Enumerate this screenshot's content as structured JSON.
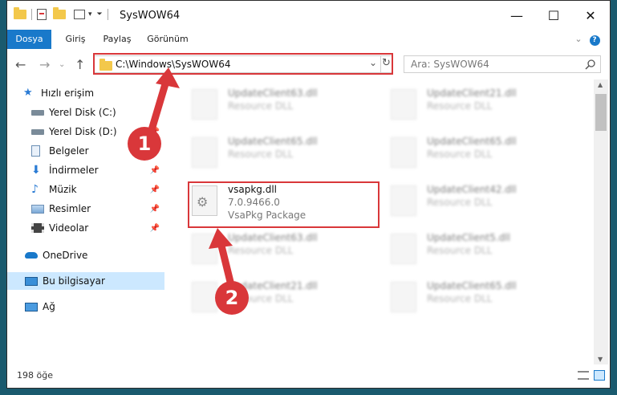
{
  "window": {
    "title": "SysWOW64",
    "minimize": "—",
    "maximize": "☐",
    "close": "✕"
  },
  "ribbon": {
    "tabs": [
      "Dosya",
      "Giriş",
      "Paylaş",
      "Görünüm"
    ],
    "expand": "⌄",
    "help": "?"
  },
  "address": {
    "path": "C:\\Windows\\SysWOW64",
    "back": "←",
    "forward": "→",
    "up": "↑",
    "refresh": "↻",
    "dropdown": "⌄"
  },
  "search": {
    "placeholder": "Ara: SysWOW64",
    "icon": "search-icon"
  },
  "sidebar": {
    "items": [
      {
        "label": "Hızlı erişim",
        "icon": "star-icon"
      },
      {
        "label": "Yerel Disk (C:)",
        "icon": "drive-icon"
      },
      {
        "label": "Yerel Disk (D:)",
        "icon": "drive-icon"
      },
      {
        "label": "Belgeler",
        "icon": "document-icon"
      },
      {
        "label": "İndirmeler",
        "icon": "download-icon"
      },
      {
        "label": "Müzik",
        "icon": "music-icon"
      },
      {
        "label": "Resimler",
        "icon": "picture-icon"
      },
      {
        "label": "Videolar",
        "icon": "video-icon"
      },
      {
        "label": "OneDrive",
        "icon": "cloud-icon"
      },
      {
        "label": "Bu bilgisayar",
        "icon": "computer-icon"
      },
      {
        "label": "Ağ",
        "icon": "network-icon"
      }
    ]
  },
  "files": [
    {
      "name": "UpdateClient63.dll",
      "sub": "Resource DLL"
    },
    {
      "name": "UpdateClient21.dll",
      "sub": "Resource DLL"
    },
    {
      "name": "UpdateClient65.dll",
      "sub": "Resource DLL"
    },
    {
      "name": "UpdateClient65.dll",
      "sub": "Resource DLL"
    },
    {
      "name": "vsapkg.dll",
      "sub": "7.0.9466.0",
      "sub2": "VsaPkg Package"
    },
    {
      "name": "UpdateClient42.dll",
      "sub": "Resource DLL"
    },
    {
      "name": "UpdateClient63.dll",
      "sub": "Resource DLL"
    },
    {
      "name": "UpdateClient5.dll",
      "sub": "Resource DLL"
    },
    {
      "name": "UpdateClient21.dll",
      "sub": "Resource DLL"
    },
    {
      "name": "UpdateClient65.dll",
      "sub": "Resource DLL"
    }
  ],
  "status": {
    "count": "198 öğe"
  },
  "annotations": {
    "badge1": "1",
    "badge2": "2"
  },
  "colors": {
    "accent": "#1979ca",
    "highlight": "#d9373a",
    "selected": "#cce8ff"
  }
}
